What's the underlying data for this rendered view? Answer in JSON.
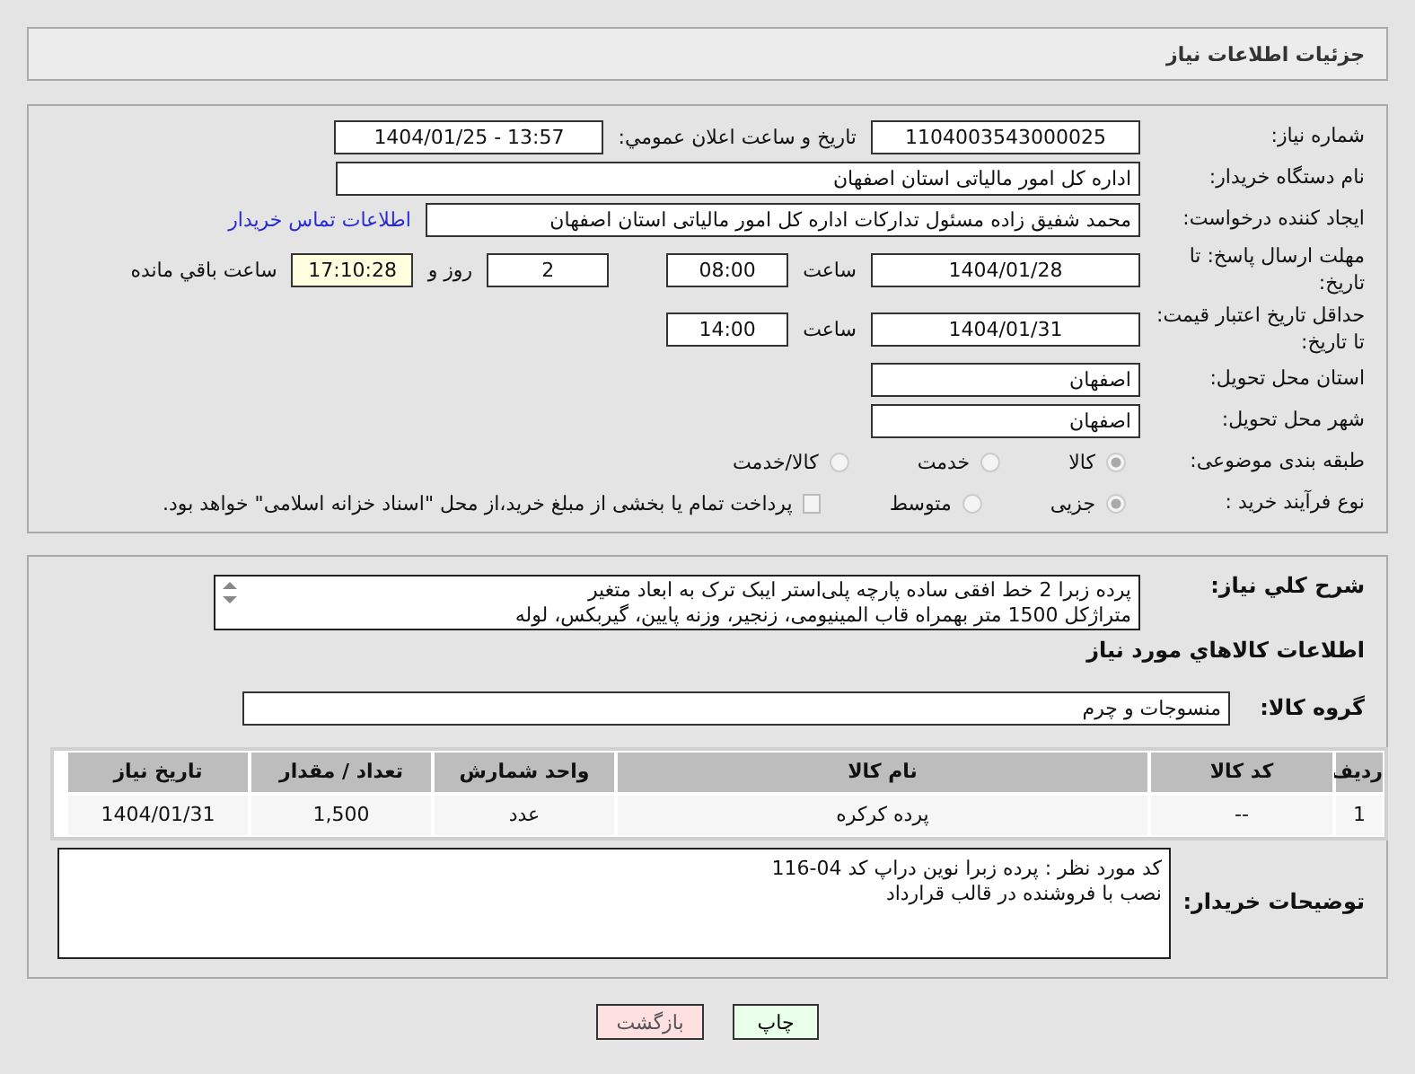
{
  "header": {
    "title": "جزئیات اطلاعات نیاز"
  },
  "need_number": {
    "label": "شماره نیاز:",
    "value": "1104003543000025"
  },
  "announce": {
    "label": "تاریخ و ساعت اعلان عمومي:",
    "value": "1404/01/25 - 13:57"
  },
  "buyer": {
    "label": "نام دستگاه خریدار:",
    "value": "اداره کل امور مالیاتی استان اصفهان"
  },
  "creator": {
    "label": "ایجاد کننده درخواست:",
    "value": "محمد شفیق زاده مسئول تدارکات اداره کل امور مالیاتی استان اصفهان",
    "link": "اطلاعات تماس خریدار"
  },
  "deadline": {
    "label": "مهلت ارسال پاسخ: تا تاریخ:",
    "date": "1404/01/28",
    "time_label": "ساعت",
    "time": "08:00",
    "days": "2",
    "days_label": "روز و",
    "remaining": "17:10:28",
    "remaining_label": "ساعت باقي مانده"
  },
  "validity": {
    "label": "حداقل تاریخ اعتبار قیمت: تا تاریخ:",
    "date": "1404/01/31",
    "time_label": "ساعت",
    "time": "14:00"
  },
  "province": {
    "label": "استان محل تحویل:",
    "value": "اصفهان"
  },
  "city": {
    "label": "شهر محل تحویل:",
    "value": "اصفهان"
  },
  "category": {
    "label": "طبقه بندی موضوعی:",
    "options": [
      {
        "label": "کالا",
        "selected": true
      },
      {
        "label": "خدمت",
        "selected": false
      },
      {
        "label": "کالا/خدمت",
        "selected": false
      }
    ]
  },
  "purchase_type": {
    "label": "نوع فرآیند خرید :",
    "options": [
      {
        "label": "جزیی",
        "selected": true
      },
      {
        "label": "متوسط",
        "selected": false
      }
    ],
    "payment": {
      "label": "پرداخت تمام یا بخشی از مبلغ خرید،از محل \"اسناد خزانه اسلامی\" خواهد بود.",
      "checked": false
    }
  },
  "description": {
    "label": "شرح کلي نياز:",
    "lines": [
      "پرده زبرا 2 خط افقی ساده پارچه پلی‌استر ایبک ترک به ابعاد متغیر",
      "متراژکل 1500 متر بهمراه قاب المینیومی، زنجیر، وزنه پایین، گیربکس، لوله"
    ]
  },
  "goods_heading": "اطلاعات كالاهاي مورد نياز",
  "goods_group": {
    "label": "گروه کالا:",
    "value": "منسوجات و چرم"
  },
  "table": {
    "columns": [
      "ردیف",
      "کد کالا",
      "نام کالا",
      "واحد شمارش",
      "تعداد / مقدار",
      "تاریخ نیاز"
    ],
    "rows": [
      [
        "1",
        "--",
        "پرده کرکره",
        "عدد",
        "1,500",
        "1404/01/31"
      ]
    ]
  },
  "buyer_notes": {
    "label": "توضیحات خریدار:",
    "lines": [
      "کد مورد نظر : پرده زبرا نوین دراپ کد 04-116",
      "نصب با فروشنده در قالب قرارداد"
    ]
  },
  "buttons": [
    {
      "label": "چاپ",
      "kind": "print"
    },
    {
      "label": "بازگشت",
      "kind": "back"
    }
  ]
}
